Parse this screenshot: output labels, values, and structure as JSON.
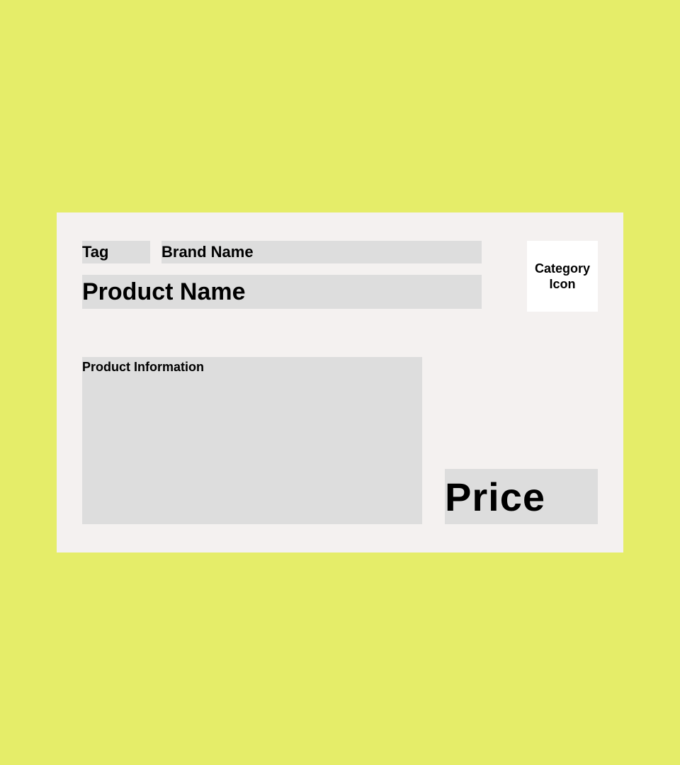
{
  "card": {
    "tag": "Tag",
    "brand_name": "Brand Name",
    "product_name": "Product Name",
    "category_icon": "Category Icon",
    "product_information": "Product Information",
    "price": "Price"
  },
  "colors": {
    "background": "#e5ed69",
    "card": "#f4f1f0",
    "field": "#dddddd",
    "icon_box": "#ffffff",
    "text": "#000000"
  }
}
